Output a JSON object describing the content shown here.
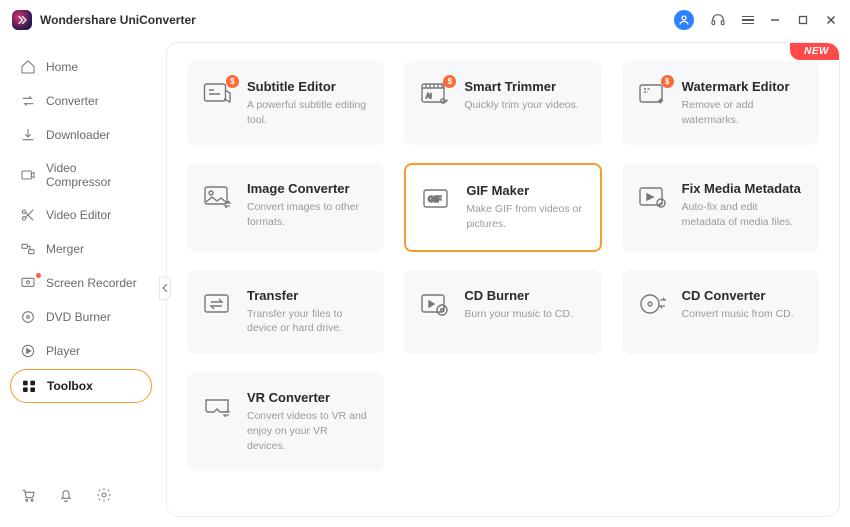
{
  "app": {
    "title": "Wondershare UniConverter"
  },
  "titlebar": {
    "new_badge": "NEW"
  },
  "sidebar": {
    "items": [
      {
        "label": "Home"
      },
      {
        "label": "Converter"
      },
      {
        "label": "Downloader"
      },
      {
        "label": "Video Compressor"
      },
      {
        "label": "Video Editor"
      },
      {
        "label": "Merger"
      },
      {
        "label": "Screen Recorder"
      },
      {
        "label": "DVD Burner"
      },
      {
        "label": "Player"
      },
      {
        "label": "Toolbox"
      }
    ]
  },
  "tools": [
    {
      "title": "Subtitle Editor",
      "desc": "A powerful subtitle editing tool.",
      "badge": "$"
    },
    {
      "title": "Smart Trimmer",
      "desc": "Quickly trim your videos.",
      "badge": "$"
    },
    {
      "title": "Watermark Editor",
      "desc": "Remove or add watermarks.",
      "badge": "$"
    },
    {
      "title": "Image Converter",
      "desc": "Convert images to other formats."
    },
    {
      "title": "GIF Maker",
      "desc": "Make GIF from videos or pictures.",
      "highlight": true
    },
    {
      "title": "Fix Media Metadata",
      "desc": "Auto-fix and edit metadata of media files."
    },
    {
      "title": "Transfer",
      "desc": "Transfer your files to device or hard drive."
    },
    {
      "title": "CD Burner",
      "desc": "Burn your music to CD."
    },
    {
      "title": "CD Converter",
      "desc": "Convert music from CD."
    },
    {
      "title": "VR Converter",
      "desc": "Convert videos to VR and enjoy on your VR devices."
    }
  ]
}
